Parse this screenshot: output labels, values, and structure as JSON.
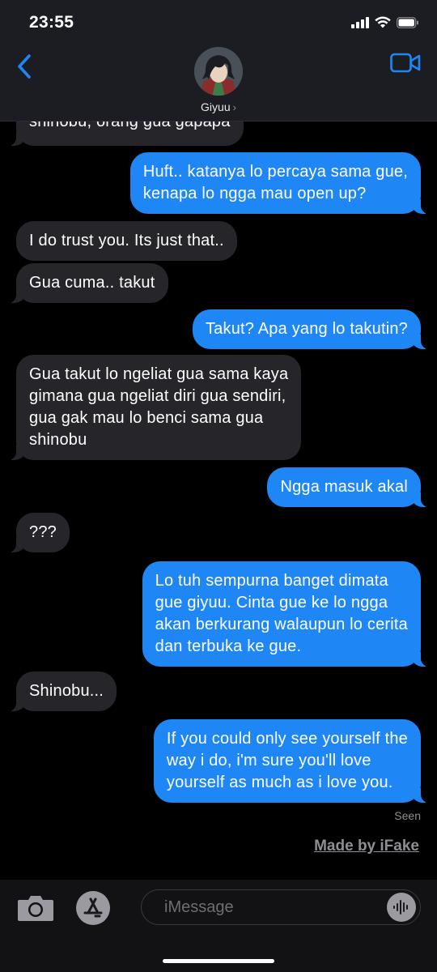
{
  "status_bar": {
    "time": "23:55"
  },
  "header": {
    "contact_name": "Giyuu",
    "chevron": "›"
  },
  "icons": {
    "back": "chevron-left-icon",
    "video": "video-camera-icon",
    "camera": "camera-icon",
    "apps": "app-store-icon",
    "audio": "waveform-icon"
  },
  "colors": {
    "sent_bubble": "#1e87f5",
    "received_bubble": "#26252a",
    "accent": "#1e87f5"
  },
  "messages": [
    {
      "from": "contact",
      "text": "shinobu, orang gua gapapa"
    },
    {
      "from": "me",
      "text": "Huft.. katanya lo percaya sama gue,\nkenapa lo ngga mau open up?"
    },
    {
      "from": "contact",
      "text": "I do trust you. Its just that.."
    },
    {
      "from": "contact",
      "text": "Gua cuma.. takut"
    },
    {
      "from": "me",
      "text": "Takut? Apa yang lo takutin?"
    },
    {
      "from": "contact",
      "text": "Gua takut lo ngeliat gua sama kaya\ngimana gua ngeliat diri gua sendiri,\ngua gak mau lo benci sama gua\nshinobu"
    },
    {
      "from": "me",
      "text": "Ngga masuk akal"
    },
    {
      "from": "contact",
      "text": "???"
    },
    {
      "from": "me",
      "text": "Lo tuh sempurna banget dimata\ngue giyuu. Cinta gue ke lo ngga\nakan berkurang walaupun lo cerita\ndan terbuka ke gue."
    },
    {
      "from": "contact",
      "text": "Shinobu..."
    },
    {
      "from": "me",
      "text": "If you could only see yourself the\nway i do, i'm sure you'll love\nyourself as much as i love you."
    }
  ],
  "read_receipt": "Seen",
  "watermark": "Made by iFake",
  "composer": {
    "placeholder": "iMessage",
    "value": ""
  }
}
